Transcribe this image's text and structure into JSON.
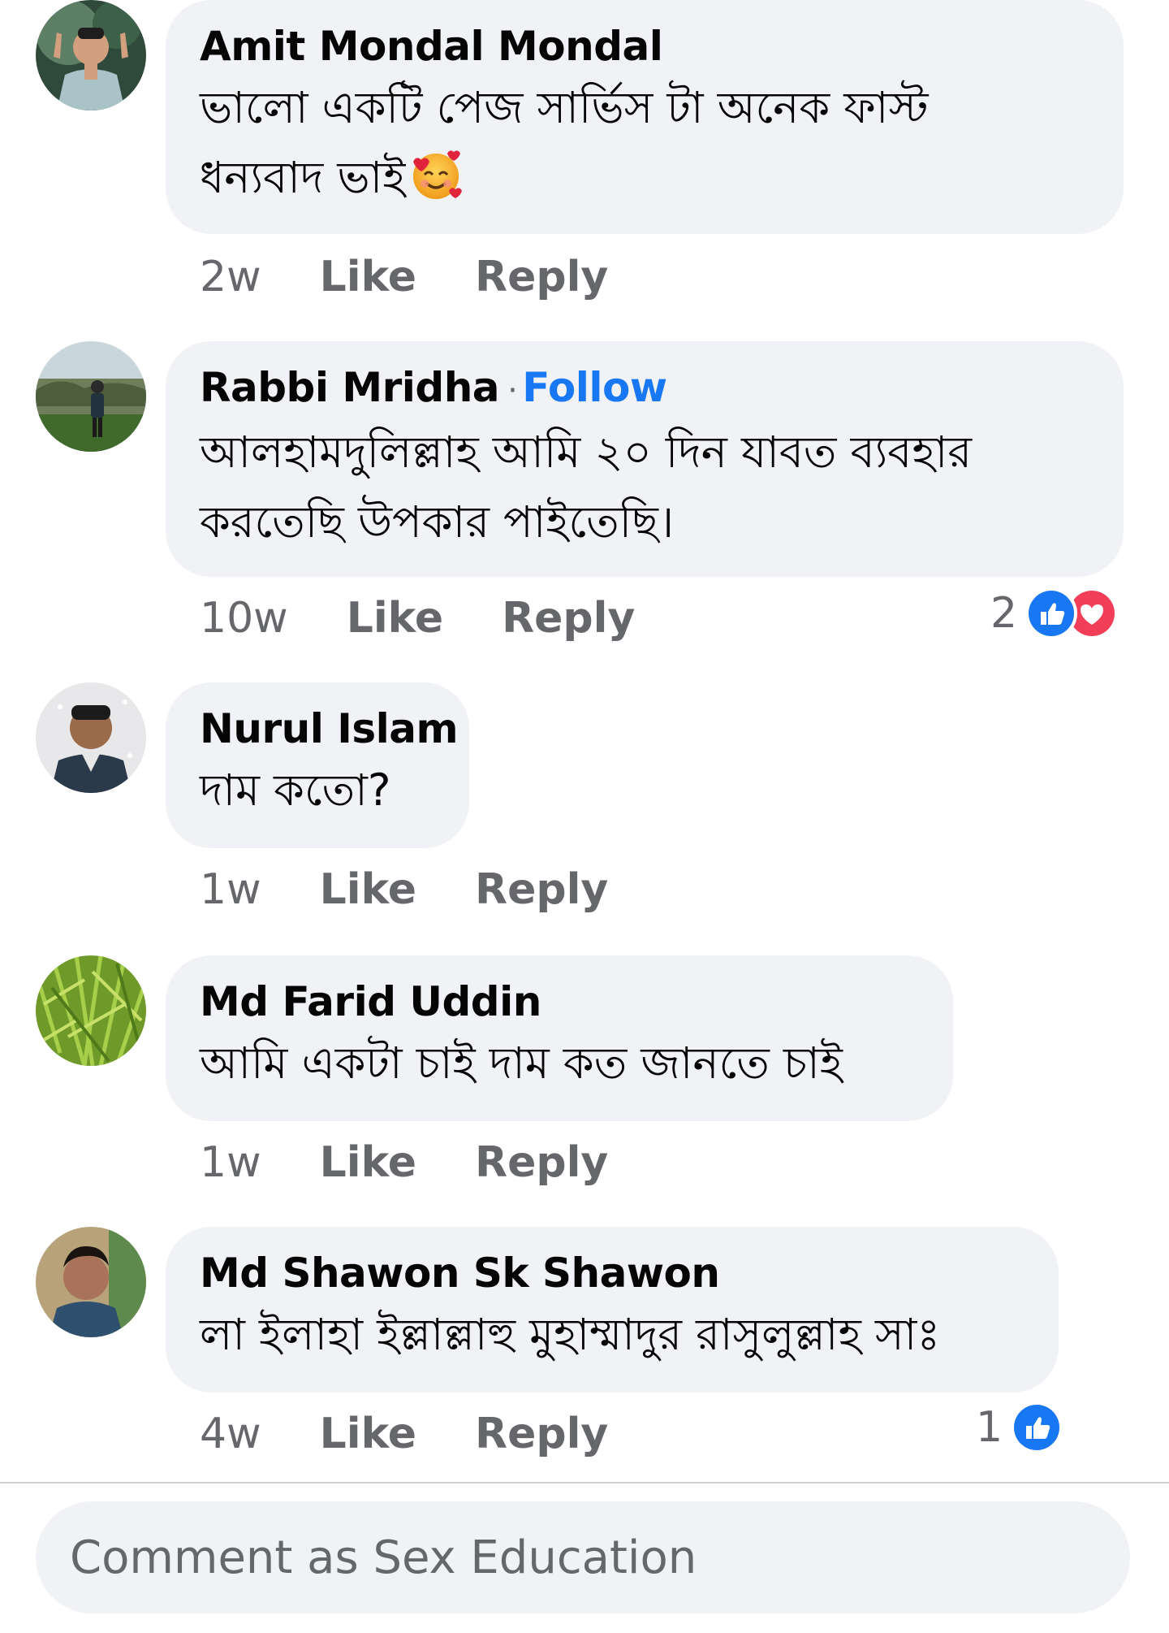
{
  "comments": [
    {
      "author": "Amit Mondal Mondal",
      "text_line1": "ভালো একটি পেজ  সার্ভিস টা অনেক ফাস্ট",
      "text_line2": "ধন্যবাদ ভাই",
      "emoji": "smiling-face-with-hearts",
      "time": "2w",
      "like_label": "Like",
      "reply_label": "Reply"
    },
    {
      "author": "Rabbi Mridha",
      "follow_separator": "·",
      "follow_label": "Follow",
      "text_line1": "আলহামদুলিল্লাহ আমি ২০ দিন যাবত  ব্যবহার",
      "text_line2": "করতেছি উপকার পাইতেছি।",
      "time": "10w",
      "like_label": "Like",
      "reply_label": "Reply",
      "reaction_count": "2",
      "reactions": [
        "like-icon",
        "heart-icon"
      ]
    },
    {
      "author": "Nurul Islam",
      "text_line1": "দাম কতো?",
      "time": "1w",
      "like_label": "Like",
      "reply_label": "Reply"
    },
    {
      "author": "Md Farid Uddin",
      "text_line1": "আমি একটা চাই দাম কত জানতে চাই",
      "time": "1w",
      "like_label": "Like",
      "reply_label": "Reply"
    },
    {
      "author": "Md Shawon Sk Shawon",
      "text_line1": "লা ইলাহা ইল্লাল্লাহু মুহাম্মাদুর রাসুলুল্লাহ সাঃ",
      "time": "4w",
      "like_label": "Like",
      "reply_label": "Reply",
      "reaction_count": "1",
      "reactions": [
        "like-icon"
      ]
    }
  ],
  "composer": {
    "placeholder": "Comment as Sex Education"
  },
  "colors": {
    "bubble_bg": "#f0f2f5",
    "link_blue": "#1877f2",
    "meta_gray": "#65676b",
    "like_blue": "#1877f2",
    "heart_red": "#f33e58"
  }
}
